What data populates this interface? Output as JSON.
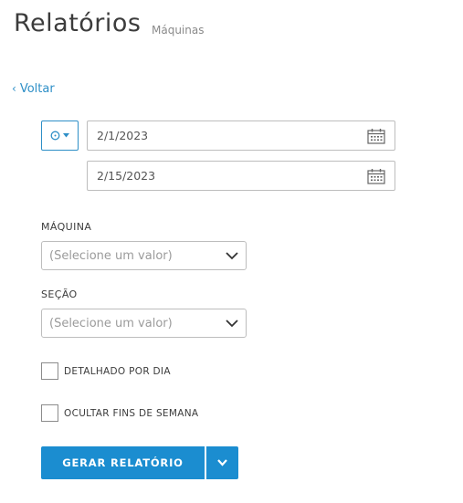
{
  "header": {
    "title": "Relatórios",
    "subtitle": "Máquinas"
  },
  "nav": {
    "back_label": "Voltar"
  },
  "date_range": {
    "start_date": "2/1/2023",
    "end_date": "2/15/2023"
  },
  "filters": {
    "machine": {
      "label": "MÁQUINA",
      "placeholder": "(Selecione um valor)"
    },
    "section": {
      "label": "SEÇÃO",
      "placeholder": "(Selecione um valor)"
    }
  },
  "options": {
    "detailed_by_day": {
      "label": "DETALHADO POR DIA",
      "checked": false
    },
    "hide_weekends": {
      "label": "OCULTAR FINS DE SEMANA",
      "checked": false
    }
  },
  "actions": {
    "generate_label": "GERAR RELATÓRIO"
  },
  "colors": {
    "accent": "#1b8dd0",
    "link": "#2e8fc7",
    "border": "#bdbdbd"
  },
  "icons": [
    "clock-icon",
    "caret-down-icon",
    "calendar-icon",
    "chevron-down-icon",
    "chevron-left-icon"
  ]
}
